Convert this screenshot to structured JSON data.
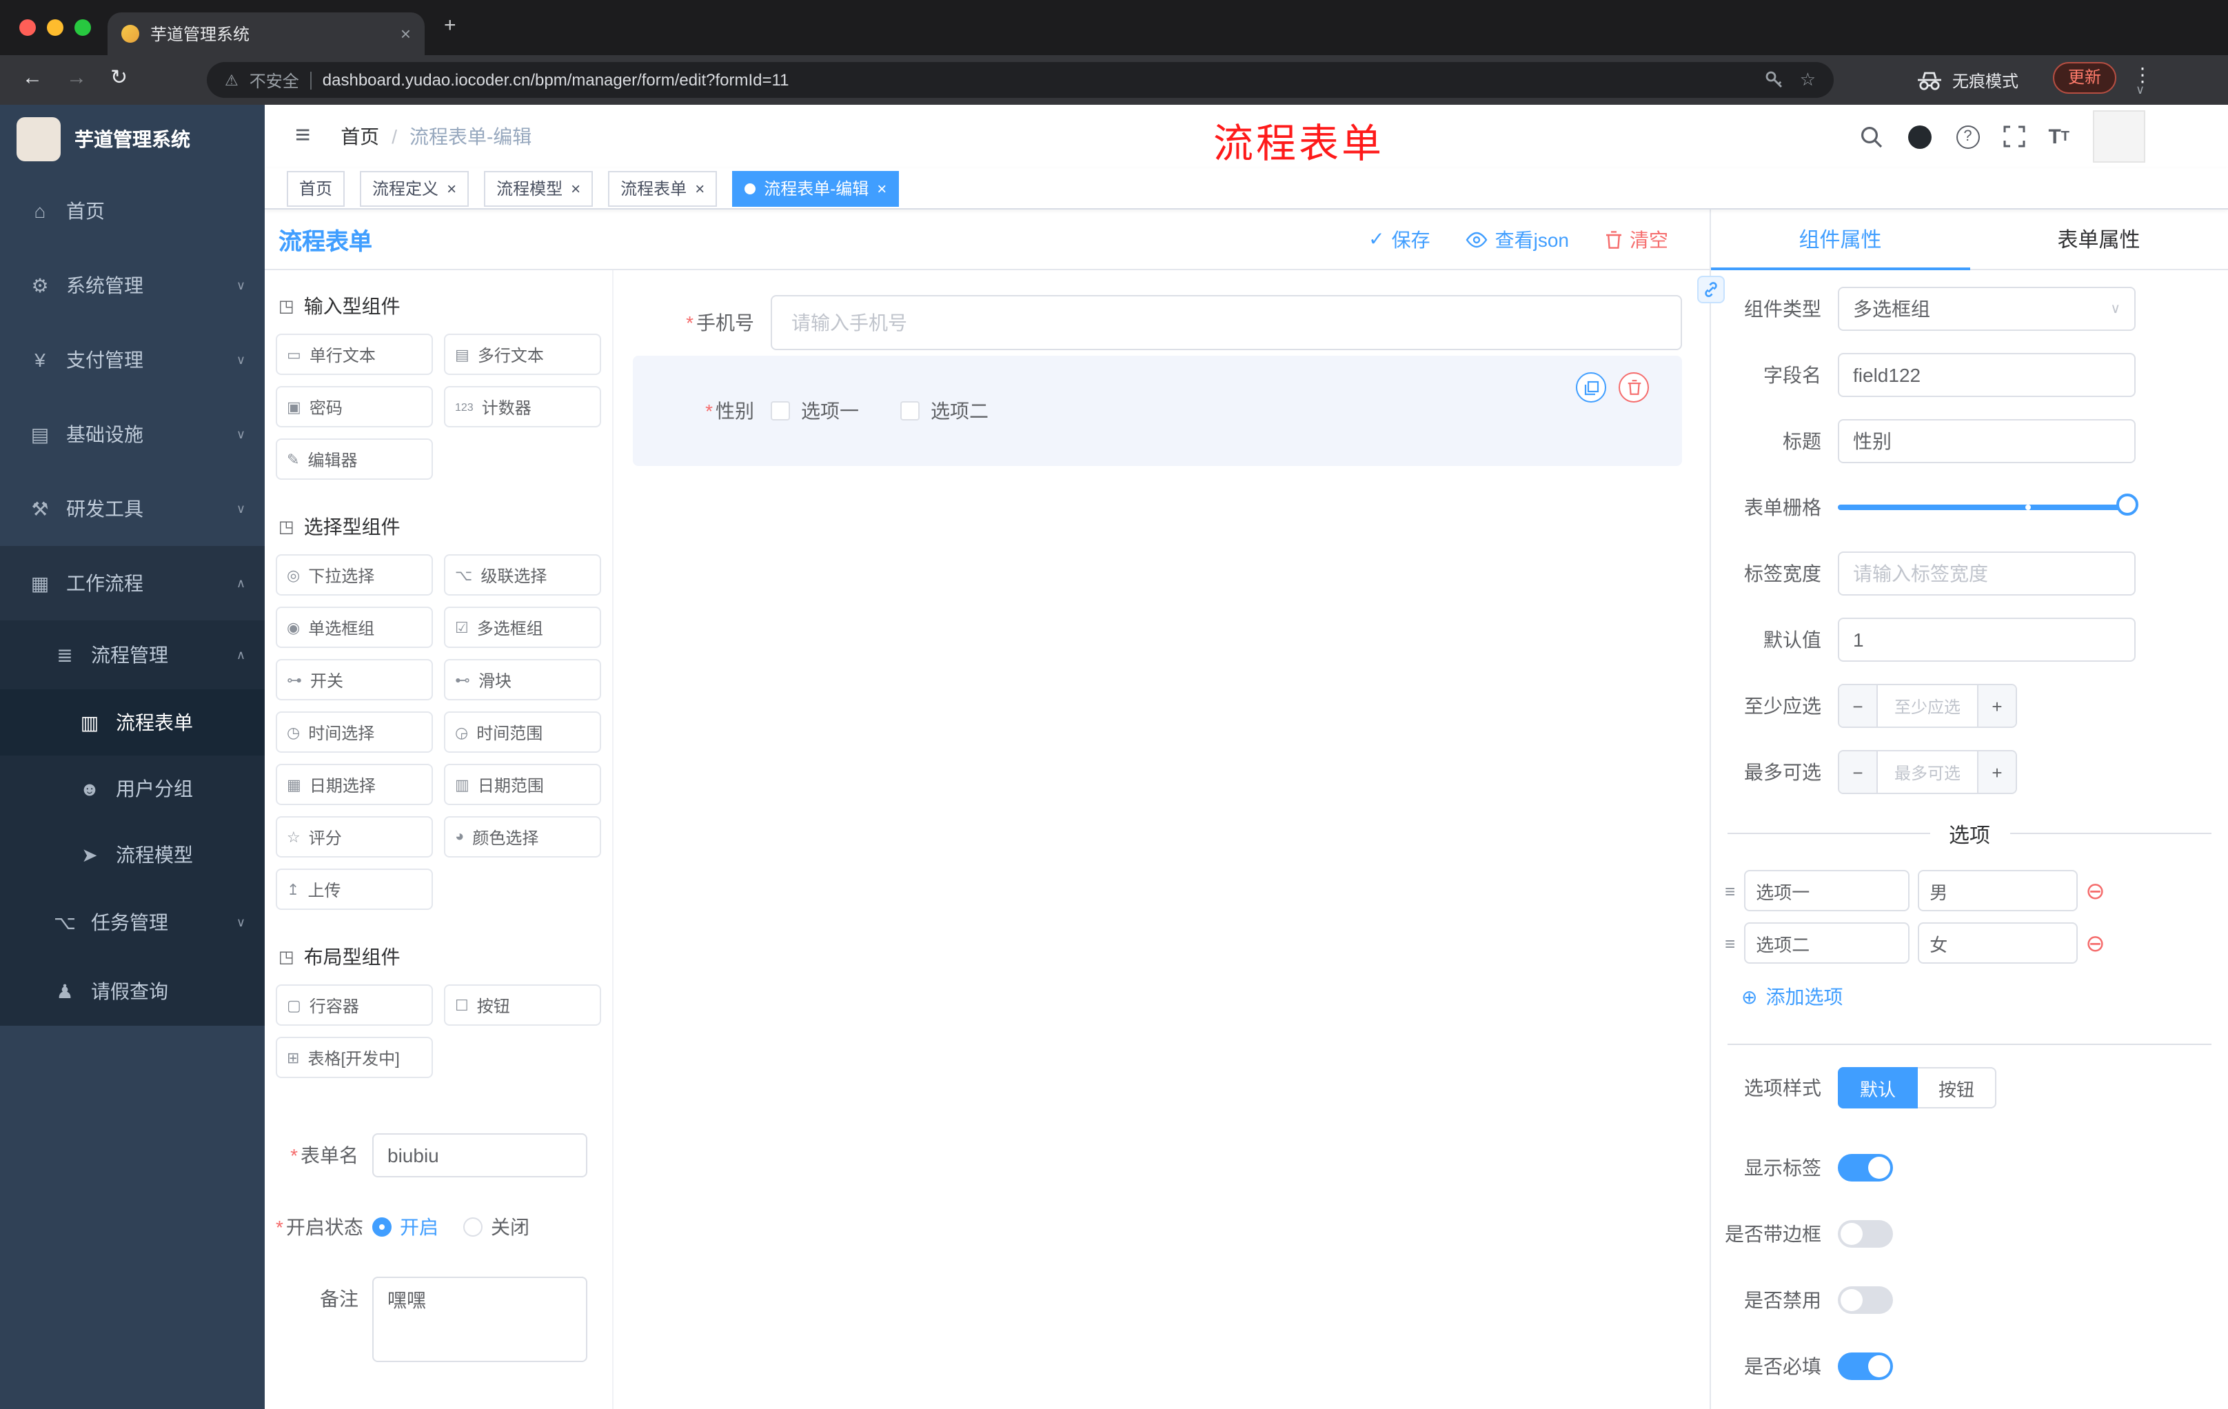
{
  "browser": {
    "tab_title": "芋道管理系统",
    "security_label": "不安全",
    "url": "dashboard.yudao.iocoder.cn/bpm/manager/form/edit?formId=11",
    "incognito_label": "无痕模式",
    "update_label": "更新"
  },
  "sidebar": {
    "logo_title": "芋道管理系统",
    "items": [
      {
        "label": "首页"
      },
      {
        "label": "系统管理"
      },
      {
        "label": "支付管理"
      },
      {
        "label": "基础设施"
      },
      {
        "label": "研发工具"
      },
      {
        "label": "工作流程"
      },
      {
        "label": "流程管理"
      },
      {
        "label": "流程表单"
      },
      {
        "label": "用户分组"
      },
      {
        "label": "流程模型"
      },
      {
        "label": "任务管理"
      },
      {
        "label": "请假查询"
      }
    ]
  },
  "header": {
    "breadcrumb_home": "首页",
    "breadcrumb_sep": "/",
    "breadcrumb_current": "流程表单-编辑",
    "annotation": "流程表单"
  },
  "tagbar": {
    "tags": [
      {
        "label": "首页"
      },
      {
        "label": "流程定义"
      },
      {
        "label": "流程模型"
      },
      {
        "label": "流程表单"
      },
      {
        "label": "流程表单-编辑"
      }
    ]
  },
  "designer": {
    "title": "流程表单",
    "save": "保存",
    "view_json": "查看json",
    "clear": "清空",
    "sections": [
      {
        "title": "输入型组件",
        "items": [
          "单行文本",
          "多行文本",
          "密码",
          "计数器",
          "编辑器"
        ]
      },
      {
        "title": "选择型组件",
        "items": [
          "下拉选择",
          "级联选择",
          "单选框组",
          "多选框组",
          "开关",
          "滑块",
          "时间选择",
          "时间范围",
          "日期选择",
          "日期范围",
          "评分",
          "颜色选择",
          "上传"
        ]
      },
      {
        "title": "布局型组件",
        "items": [
          "行容器",
          "按钮",
          "表格[开发中]"
        ]
      }
    ],
    "meta": {
      "form_name_label": "表单名",
      "form_name_value": "biubiu",
      "status_label": "开启状态",
      "status_on": "开启",
      "status_off": "关闭",
      "remark_label": "备注",
      "remark_value": "嘿嘿"
    }
  },
  "canvas": {
    "phone_label": "手机号",
    "phone_placeholder": "请输入手机号",
    "gender_label": "性别",
    "gender_option1": "选项一",
    "gender_option2": "选项二"
  },
  "props": {
    "tab_component": "组件属性",
    "tab_form": "表单属性",
    "component_type_label": "组件类型",
    "component_type_value": "多选框组",
    "field_name_label": "字段名",
    "field_name_value": "field122",
    "title_label": "标题",
    "title_value": "性别",
    "grid_label": "表单栅格",
    "label_width_label": "标签宽度",
    "label_width_placeholder": "请输入标签宽度",
    "default_label": "默认值",
    "default_value": "1",
    "min_label": "至少应选",
    "min_placeholder": "至少应选",
    "max_label": "最多可选",
    "max_placeholder": "最多可选",
    "options_title": "选项",
    "options": [
      {
        "label": "选项一",
        "value": "男"
      },
      {
        "label": "选项二",
        "value": "女"
      }
    ],
    "add_option": "添加选项",
    "style_label": "选项样式",
    "style_default": "默认",
    "style_button": "按钮",
    "show_label": "显示标签",
    "bordered_label": "是否带边框",
    "disabled_label": "是否禁用",
    "required_label": "是否必填"
  },
  "colors": {
    "accent": "#409EFF",
    "danger": "#F56C6C",
    "sidebar_bg": "#304156"
  },
  "icons": {
    "back": "←",
    "forward": "→",
    "reload": "↻",
    "warning": "⚠",
    "star": "☆",
    "kebab": "⋮",
    "new_tab": "+",
    "tab_close": "×",
    "caret_down": "∨",
    "hamburger": "≡",
    "home": "⌂",
    "system": "⚙",
    "payment": "¥",
    "infra": "▤",
    "devtool": "⚒",
    "workflow": "▦",
    "flow_manage": "≣",
    "flow_form": "▥",
    "user_group": "☻",
    "flow_model": "➤",
    "task_manage": "⌥",
    "leave_query": "♟",
    "chev_down": "∨",
    "chev_up": "∧",
    "section_box": "◳",
    "chip_single_line": "▭",
    "chip_multi_line": "▤",
    "chip_password": "▣",
    "chip_counter": "123",
    "chip_editor": "✎",
    "chip_select": "◎",
    "chip_cascade": "⌥",
    "chip_radio": "◉",
    "chip_checkbox": "☑",
    "chip_switch": "⊶",
    "chip_slider": "⊷",
    "chip_time": "◷",
    "chip_time_range": "◶",
    "chip_date": "▦",
    "chip_date_range": "▥",
    "chip_rate": "☆",
    "chip_color": "◕",
    "chip_upload": "↥",
    "chip_row": "▢",
    "chip_button": "☐",
    "chip_table": "⊞",
    "save_check": "✓",
    "help": "?",
    "minus": "−",
    "plus": "+",
    "remove_option": "⊖",
    "add_option_icon": "⊕",
    "option_drag": "≡"
  }
}
